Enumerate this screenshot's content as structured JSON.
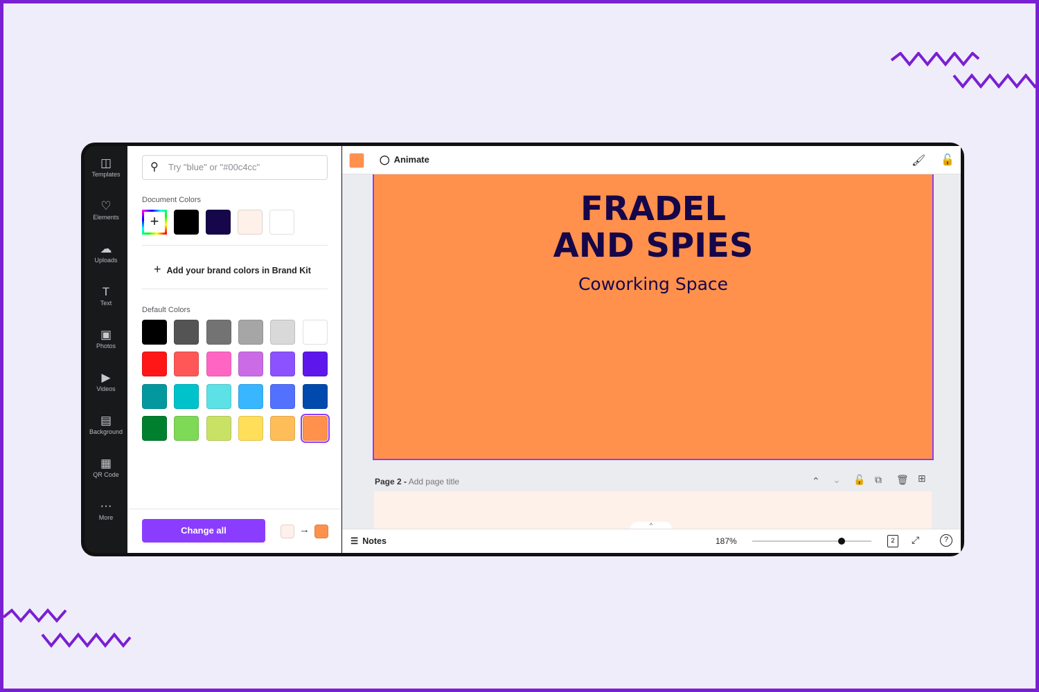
{
  "sidebar": {
    "items": [
      {
        "label": "Templates",
        "icon": "templates-icon"
      },
      {
        "label": "Elements",
        "icon": "elements-icon"
      },
      {
        "label": "Uploads",
        "icon": "upload-cloud-icon"
      },
      {
        "label": "Text",
        "icon": "text-icon"
      },
      {
        "label": "Photos",
        "icon": "photo-icon"
      },
      {
        "label": "Videos",
        "icon": "video-icon"
      },
      {
        "label": "Background",
        "icon": "background-icon"
      },
      {
        "label": "QR Code",
        "icon": "qr-code-icon"
      },
      {
        "label": "More",
        "icon": "more-icon"
      }
    ]
  },
  "panel": {
    "search_placeholder": "Try \"blue\" or \"#00c4cc\"",
    "document_colors_label": "Document Colors",
    "document_colors": [
      "#000000",
      "#16064a",
      "#fef1e9",
      "#ffffff"
    ],
    "brand_kit_label": "Add your brand colors in Brand Kit",
    "default_colors_label": "Default Colors",
    "default_colors": [
      "#000000",
      "#545454",
      "#737373",
      "#a6a6a6",
      "#d9d9d9",
      "#ffffff",
      "#ff1616",
      "#ff5757",
      "#ff66c4",
      "#cb6ce6",
      "#8c52ff",
      "#5e17eb",
      "#03989e",
      "#00c2cb",
      "#5ce1e6",
      "#38b6ff",
      "#5271ff",
      "#004aad",
      "#00802f",
      "#7ed957",
      "#c9e265",
      "#ffde59",
      "#ffbd59",
      "#ff914d"
    ],
    "selected_color": "#ff914d",
    "change_all_label": "Change all",
    "change_from": "#fef1e9",
    "change_to": "#ff914d"
  },
  "toolbar": {
    "current_color": "#ff914d",
    "animate_label": "Animate"
  },
  "canvas": {
    "title_line1": "FRADEL",
    "title_line2": "AND SPIES",
    "subtitle": "Coworking Space",
    "page_bg": "#ff914d",
    "text_color": "#16064a"
  },
  "page2": {
    "label": "Page 2 -",
    "title_placeholder": "Add page title"
  },
  "bottom": {
    "notes_label": "Notes",
    "zoom": "187%",
    "zoom_fraction": 0.75,
    "page_count": "2"
  },
  "accent": "#8b3dff"
}
